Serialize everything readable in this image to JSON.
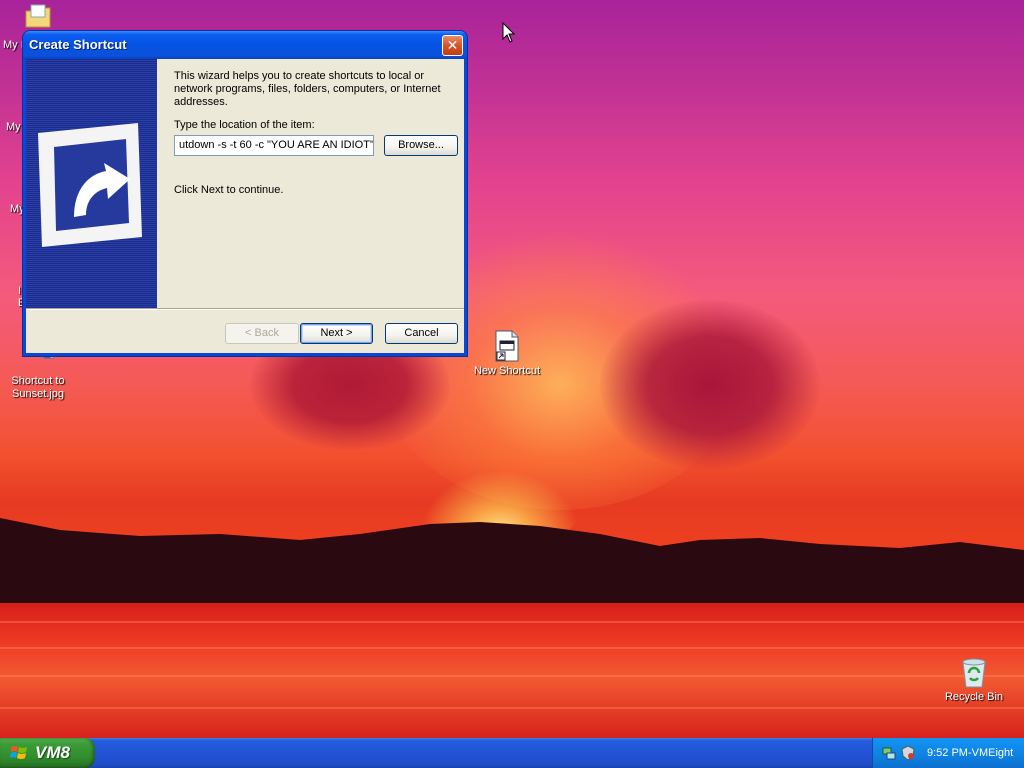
{
  "desktop": {
    "left_labels": [
      "My I",
      "My",
      "My",
      "I",
      "E"
    ],
    "icons": [
      {
        "label_line1": "Shortcut to",
        "label_line2": "Sunset.jpg"
      },
      {
        "label_line1": "New Shortcut",
        "label_line2": ""
      },
      {
        "label_line1": "Recycle Bin",
        "label_line2": ""
      }
    ]
  },
  "dialog": {
    "title": "Create Shortcut",
    "close_glyph": "✕",
    "intro": "This wizard helps you to create shortcuts to local or network programs, files, folders, computers, or Internet addresses.",
    "location_label": "Type the location of the item:",
    "location_value": "utdown -s -t 60 -c \"YOU ARE AN IDIOT\"",
    "browse_label": "Browse...",
    "continue_text": "Click Next to continue.",
    "back_label": "< Back",
    "next_label": "Next >",
    "cancel_label": "Cancel"
  },
  "taskbar": {
    "start_label": "VM8",
    "clock": "9:52 PM-VMEight",
    "tray_icons": [
      "network-icon",
      "security-icon"
    ]
  },
  "colors": {
    "title_bar": "#0652e2",
    "dialog_face": "#ece9d8",
    "taskbar": "#245edb",
    "start_button": "#3c9c39"
  }
}
